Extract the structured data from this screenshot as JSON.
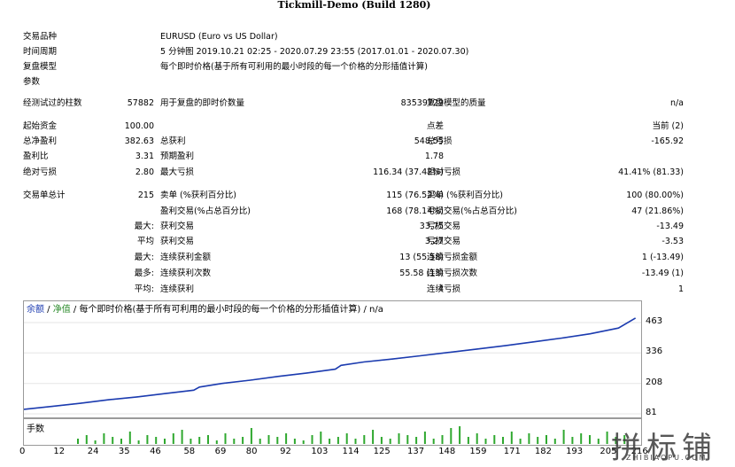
{
  "window_title": "Tickmill-Demo (Build 1280)",
  "header": {
    "symbol_label": "交易品种",
    "symbol_value": "EURUSD (Euro vs US Dollar)",
    "period_label": "时间周期",
    "period_value": "5 分钟图 2019.10.21 02:25 - 2020.07.29 23:55 (2017.01.01 - 2020.07.30)",
    "model_label": "复盘模型",
    "model_value": "每个即时价格(基于所有可利用的最小时段的每一个价格的分形插值计算)",
    "params_label": "参数"
  },
  "bars": {
    "bars_label": "经测试过的柱数",
    "bars_value": "57882",
    "ticks_label": "用于复盘的即时价数量",
    "ticks_value": "83539729",
    "quality_label": "复盘模型的质量",
    "quality_value": "n/a"
  },
  "stats": {
    "deposit_label": "起始资金",
    "deposit_value": "100.00",
    "spread_label": "点差",
    "spread_value": "当前 (2)",
    "net_label": "总净盈利",
    "net_value": "382.63",
    "gross_profit_label": "总获利",
    "gross_profit_value": "548.55",
    "gross_loss_label": "总亏损",
    "gross_loss_value": "-165.92",
    "pf_label": "盈利比",
    "pf_value": "3.31",
    "payoff_label": "预期盈利",
    "payoff_value": "1.78",
    "abs_dd_label": "绝对亏损",
    "abs_dd_value": "2.80",
    "max_dd_label": "最大亏损",
    "max_dd_value": "116.34 (37.42%)",
    "rel_dd_label": "相对亏损",
    "rel_dd_value": "41.41% (81.33)"
  },
  "trades": {
    "total_label": "交易单总计",
    "total_value": "215",
    "short_label": "卖单 (%获利百分比)",
    "short_value": "115 (76.52%)",
    "long_label": "买单 (%获利百分比)",
    "long_value": "100 (80.00%)",
    "profit_trades_label": "盈利交易(%占总百分比)",
    "profit_trades_value": "168 (78.14%)",
    "loss_trades_label": "亏损交易(%占总百分比)",
    "loss_trades_value": "47 (21.86%)",
    "largest_prefix": "最大:",
    "largest_profit_label": "获利交易",
    "largest_profit_value": "33.75",
    "largest_loss_label": "亏损交易",
    "largest_loss_value": "-13.49",
    "average_prefix": "平均",
    "average_profit_label": "获利交易",
    "average_profit_value": "3.27",
    "average_loss_label": "亏损交易",
    "average_loss_value": "-3.53",
    "max_prefix": "最大:",
    "max_cons_wins_label": "连续获利金额",
    "max_cons_wins_value": "13 (55.58)",
    "max_cons_losses_label": "连续亏损金额",
    "max_cons_losses_value": "1 (-13.49)",
    "maximal_prefix": "最多:",
    "maximal_cons_profit_label": "连续获利次数",
    "maximal_cons_profit_value": "55.58 (13)",
    "maximal_cons_loss_label": "连续亏损次数",
    "maximal_cons_loss_value": "-13.49 (1)",
    "avg_cons_prefix": "平均:",
    "avg_cons_wins_label": "连续获利",
    "avg_cons_wins_value": "4",
    "avg_cons_losses_label": "连续亏损",
    "avg_cons_losses_value": "1"
  },
  "graph_legend": {
    "balance": "余额",
    "sep1": " / ",
    "equity": "净值",
    "rest": " / 每个即时价格(基于所有可利用的最小时段的每一个价格的分形插值计算) / n/a"
  },
  "volume_label": "手数",
  "colors": {
    "balance": "#1c3bb0",
    "equity": "#2a8a2a",
    "volume": "#2fa82f"
  },
  "watermark": {
    "text": "拼标铺",
    "sub": "ZHIBIAOPU.COM"
  },
  "chart_data": {
    "type": "line",
    "series": [
      {
        "name": "余额",
        "x": [
          0,
          10,
          20,
          30,
          40,
          50,
          60,
          62,
          70,
          80,
          90,
          100,
          110,
          112,
          120,
          130,
          140,
          150,
          160,
          170,
          180,
          190,
          200,
          210,
          216
        ],
        "values": [
          100,
          112,
          125,
          140,
          152,
          166,
          180,
          193,
          208,
          222,
          238,
          252,
          268,
          284,
          298,
          310,
          324,
          338,
          352,
          366,
          382,
          398,
          416,
          440,
          482
        ]
      }
    ],
    "y_ticks": [
      463,
      336,
      208,
      81
    ],
    "ylim": [
      81,
      500
    ],
    "x_ticks": [
      0,
      12,
      24,
      35,
      46,
      58,
      69,
      80,
      92,
      103,
      114,
      125,
      137,
      148,
      159,
      171,
      182,
      193,
      205,
      216
    ],
    "xlim": [
      0,
      218
    ],
    "volume": [
      0.3,
      0.5,
      0.2,
      0.6,
      0.4,
      0.3,
      0.7,
      0.2,
      0.5,
      0.4,
      0.3,
      0.6,
      0.8,
      0.3,
      0.4,
      0.5,
      0.2,
      0.6,
      0.3,
      0.4,
      0.9,
      0.3,
      0.5,
      0.4,
      0.6,
      0.3,
      0.2,
      0.5,
      0.7,
      0.3,
      0.4,
      0.6,
      0.3,
      0.5,
      0.8,
      0.4,
      0.3,
      0.6,
      0.5,
      0.4,
      0.7,
      0.3,
      0.5,
      0.9,
      1.0,
      0.4,
      0.6,
      0.3,
      0.5,
      0.4,
      0.7,
      0.3,
      0.6,
      0.4,
      0.5,
      0.3,
      0.8,
      0.4,
      0.6,
      0.5,
      0.3,
      0.7,
      0.4,
      0.5
    ]
  }
}
